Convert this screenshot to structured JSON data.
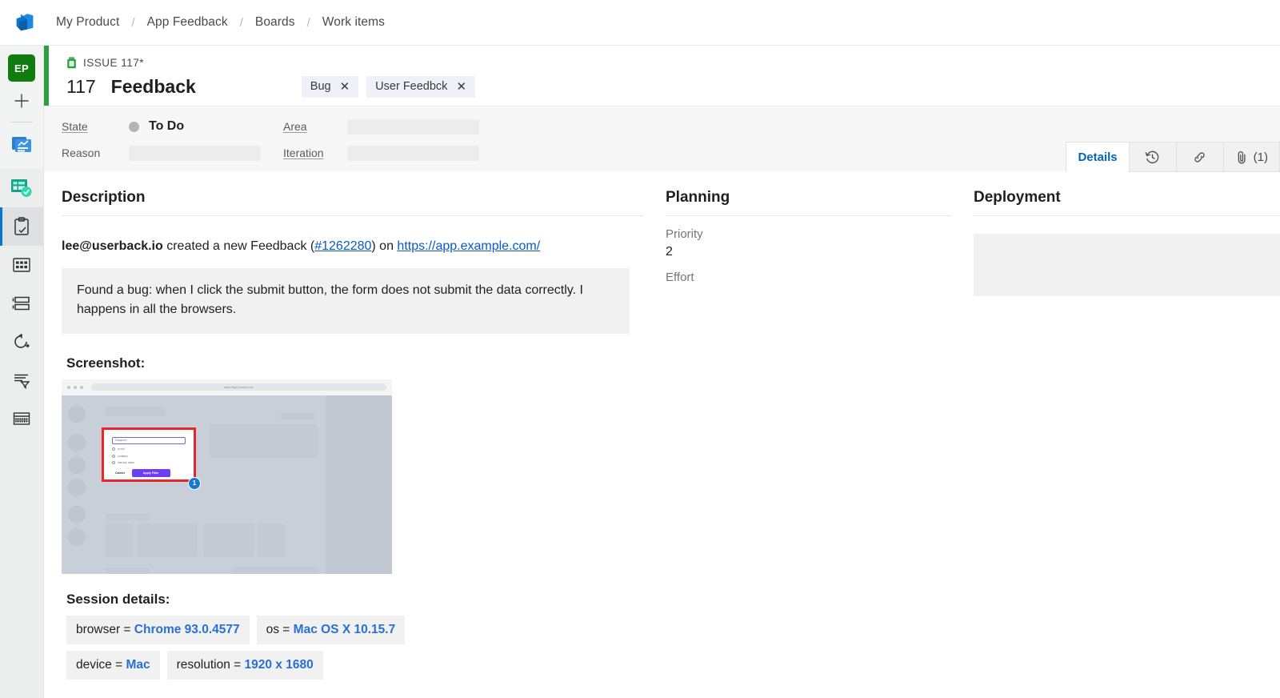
{
  "topbar": {
    "logo_icon": "azure-devops-logo",
    "breadcrumbs": [
      {
        "label": "My Product"
      },
      {
        "label": "App Feedback"
      },
      {
        "label": "Boards"
      },
      {
        "label": "Work items"
      }
    ],
    "separator": "/"
  },
  "rail": {
    "avatar_initials": "EP",
    "items": [
      {
        "icon": "plus-icon",
        "name": "new-item"
      },
      {
        "icon": "overview-icon",
        "name": "overview"
      },
      {
        "icon": "boards-icon",
        "name": "boards"
      },
      {
        "icon": "work-items-icon",
        "name": "work-items",
        "selected": true
      },
      {
        "icon": "boards-grid-icon",
        "name": "boards-grid"
      },
      {
        "icon": "backlogs-icon",
        "name": "backlogs"
      },
      {
        "icon": "sprints-icon",
        "name": "sprints"
      },
      {
        "icon": "queries-icon",
        "name": "queries"
      },
      {
        "icon": "delivery-plans-icon",
        "name": "delivery-plans"
      }
    ]
  },
  "workitem": {
    "issue_label": "ISSUE 117*",
    "issue_icon": "issue-green-icon",
    "id": "117",
    "title": "Feedback",
    "accent_color": "#2f9e41",
    "tags": [
      {
        "label": "Bug",
        "remove": "✕"
      },
      {
        "label": "User Feedbck",
        "remove": "✕"
      }
    ],
    "fields": {
      "state_label": "State",
      "state_value": "To Do",
      "reason_label": "Reason",
      "reason_value": "",
      "area_label": "Area",
      "area_value": "",
      "iteration_label": "Iteration",
      "iteration_value": ""
    },
    "tabs": [
      {
        "label": "Details",
        "icon": "",
        "active": true,
        "name": "tab-details"
      },
      {
        "label": "",
        "icon": "history-clock-icon",
        "active": false,
        "name": "tab-history"
      },
      {
        "label": "",
        "icon": "link-icon",
        "active": false,
        "name": "tab-links"
      },
      {
        "label": "(1)",
        "icon": "paperclip-icon",
        "active": false,
        "name": "tab-attachments"
      }
    ]
  },
  "description": {
    "heading": "Description",
    "author": "lee@userback.io",
    "created_text": " created a new Feedback (",
    "feedback_link": "#1262280",
    "on_text": ") on ",
    "site_link": "https://app.example.com/",
    "quote": "Found a bug: when I click the submit button, the form does not submit the data correctly. I happens in all the browsers.",
    "screenshot_heading": "Screenshot:",
    "screenshot": {
      "url": "https://app.product.com",
      "annotation_badge": "1",
      "dialog": {
        "input_value": "Datapoint",
        "options": [
          "is null",
          "contains",
          "has any value"
        ],
        "cancel_label": "Cancel",
        "apply_label": "Apply Filter",
        "highlight_color": "#e8262a",
        "accent_color": "#6d3ff0"
      }
    },
    "session_heading": "Session details:",
    "session_rows": [
      [
        {
          "key": "browser = ",
          "value": "Chrome 93.0.4577"
        },
        {
          "key": "os = ",
          "value": "Mac OS X 10.15.7"
        }
      ],
      [
        {
          "key": "device = ",
          "value": "Mac"
        },
        {
          "key": "resolution = ",
          "value": "1920 x 1680"
        }
      ]
    ]
  },
  "planning": {
    "heading": "Planning",
    "priority_label": "Priority",
    "priority_value": "2",
    "effort_label": "Effort",
    "effort_value": ""
  },
  "deployment": {
    "heading": "Deployment"
  }
}
